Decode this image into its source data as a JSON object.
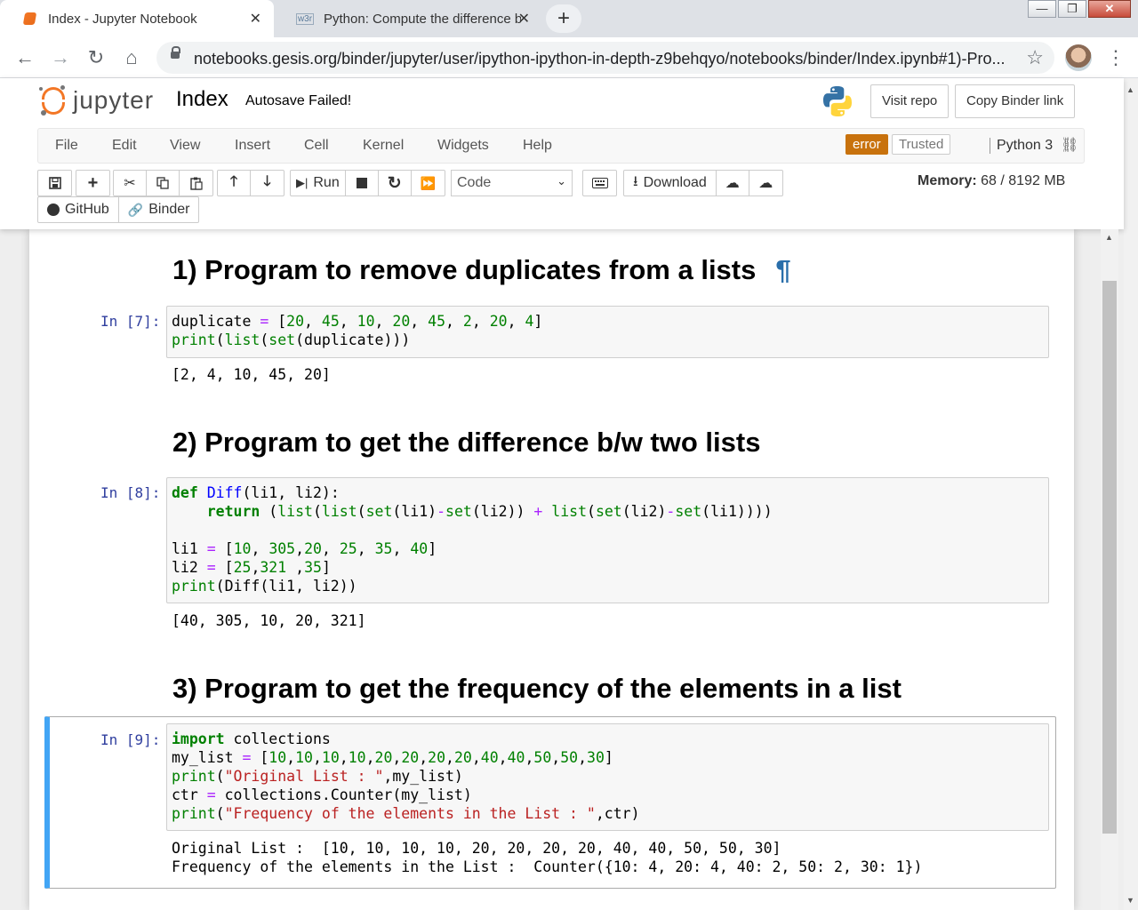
{
  "browser": {
    "tabs": [
      {
        "title": "Index - Jupyter Notebook",
        "close": "✕"
      },
      {
        "title": "Python: Compute the difference b",
        "close": "✕"
      }
    ],
    "new_tab": "+",
    "window_controls": {
      "minimize": "—",
      "maximize": "❐",
      "close": "✕"
    },
    "url": "notebooks.gesis.org/binder/jupyter/user/ipython-ipython-in-depth-z9behqyo/notebooks/binder/Index.ipynb#1)-Pro...",
    "back": "←",
    "forward": "→",
    "reload": "↻",
    "home": "⌂",
    "star": "☆",
    "menu": "⋮",
    "favicon_w3r": "w3r"
  },
  "jupyter": {
    "logo_text": "jupyter",
    "notebook_name": "Index",
    "autosave_status": "Autosave Failed!",
    "visit_repo": "Visit repo",
    "copy_binder_link": "Copy Binder link",
    "menu": [
      "File",
      "Edit",
      "View",
      "Insert",
      "Cell",
      "Kernel",
      "Widgets",
      "Help"
    ],
    "kernel_error": "error",
    "trusted": "Trusted",
    "kernel_name": "Python 3",
    "toolbar": {
      "run": "Run",
      "cell_type": "Code",
      "download": "Download",
      "github": "GitHub",
      "binder": "Binder"
    },
    "memory_label": "Memory:",
    "memory_value": "68 / 8192 MB"
  },
  "notebook": {
    "headings": [
      "1) Program to remove duplicates from a lists",
      "2) Program to get the difference b/w two lists",
      "3) Program to get the frequency of the elements in a list"
    ],
    "anchor": "¶",
    "cells": [
      {
        "prompt": "In [7]:",
        "output": "[2, 4, 10, 45, 20]"
      },
      {
        "prompt": "In [8]:",
        "output": "[40, 305, 10, 20, 321]"
      },
      {
        "prompt": "In [9]:",
        "output": "Original List :  [10, 10, 10, 10, 20, 20, 20, 20, 40, 40, 50, 50, 30]\nFrequency of the elements in the List :  Counter({10: 4, 20: 4, 40: 2, 50: 2, 30: 1})"
      }
    ],
    "code": {
      "c1_l1_a": "duplicate",
      "c1_l1_b": "=",
      "c1_l1_c": "[",
      "c1_l1_n": [
        "20",
        "45",
        "10",
        "20",
        "45",
        "2",
        "20",
        "4"
      ],
      "c1_l1_d": "]",
      "c1_l2_a": "print",
      "c1_l2_b": "(",
      "c1_l2_c": "list",
      "c1_l2_d": "(",
      "c1_l2_e": "set",
      "c1_l2_f": "(duplicate)))",
      "c2_l1_a": "def",
      "c2_l1_b": "Diff",
      "c2_l1_c": "(li1, li2):",
      "c2_l2_a": "return",
      "c2_l2_b": " (",
      "c2_l2_c": "list",
      "c2_l2_d": "(",
      "c2_l2_e": "list",
      "c2_l2_f": "(",
      "c2_l2_g": "set",
      "c2_l2_h": "(li1)",
      "c2_l2_i": "-",
      "c2_l2_j": "set",
      "c2_l2_k": "(li2)) ",
      "c2_l2_l": "+",
      "c2_l2_m": " list",
      "c2_l2_n": "(",
      "c2_l2_o": "set",
      "c2_l2_p": "(li2)",
      "c2_l2_q": "-",
      "c2_l2_r": "set",
      "c2_l2_s": "(li1))))",
      "c2_l4_a": "li1",
      "c2_l4_b": "=",
      "c2_l4_c": "[",
      "c2_l4_n1": "10",
      "c2_l4_n2": "305",
      "c2_l4_n3": "20",
      "c2_l4_n4": "25",
      "c2_l4_n5": "35",
      "c2_l4_n6": "40",
      "c2_l4_d": "]",
      "c2_l5_a": "li2",
      "c2_l5_b": "=",
      "c2_l5_c": "[",
      "c2_l5_n1": "25",
      "c2_l5_n2": "321",
      "c2_l5_n3": "35",
      "c2_l5_d": "]",
      "c2_l6_a": "print",
      "c2_l6_b": "(Diff(li1, li2))",
      "c3_l1_a": "import",
      "c3_l1_b": " collections",
      "c3_l2_a": "my_list",
      "c3_l2_b": "=",
      "c3_l2_n": [
        "10",
        "10",
        "10",
        "10",
        "20",
        "20",
        "20",
        "20",
        "40",
        "40",
        "50",
        "50",
        "30"
      ],
      "c3_l3_a": "print",
      "c3_l3_b": "(",
      "c3_l3_c": "\"Original List : \"",
      "c3_l3_d": ",my_list)",
      "c3_l4_a": "ctr",
      "c3_l4_b": "=",
      "c3_l4_c": " collections.Counter(my_list)",
      "c3_l5_a": "print",
      "c3_l5_b": "(",
      "c3_l5_c": "\"Frequency of the elements in the List : \"",
      "c3_l5_d": ",ctr)"
    }
  },
  "colors": {
    "jupyter_orange": "#f37726",
    "prompt_blue": "#303f9f",
    "kernel_error": "#c8720d",
    "selected_cell": "#42a5f5"
  }
}
